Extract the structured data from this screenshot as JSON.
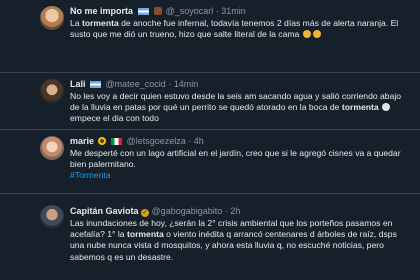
{
  "tweets": [
    {
      "name": "No me importa",
      "handle": "@_soyocarl",
      "time": "31min",
      "icons": [
        "argentina-flag-icon",
        "coffee-icon"
      ],
      "t1": "La ",
      "hl": "tormenta",
      "t2": " de anoche fue infernal, todavía tenemos 2 días más de alerta naranja. El susto que me dió un trueno, hizo que salte literal de la cama ",
      "emoji": [
        "grimacing-face-icon",
        "sweat-face-icon"
      ]
    },
    {
      "name": "Lali",
      "handle": "@matee_cocid",
      "time": "14min",
      "icons": [
        "argentina-flag-icon"
      ],
      "t1": "No les voy a decir quien estuvo desde la seis am sacando agua y salió corriendo abajo de la lluvia en patas por qué un perrito se quedó atorado en la boca de ",
      "hl": "tormenta",
      "t2": " empece el dia con todo",
      "emoji": [
        "skull-crossbones-icon"
      ]
    },
    {
      "name": "marie",
      "handle": "@letsgoezelza",
      "time": "4h",
      "icons": [
        "sunflower-icon",
        "italy-flag-icon"
      ],
      "t1": "Me desperté con un lago artificial en el jardín, creo que si le agregó cisnes va a quedar bien palermitano. ",
      "hashtag": "#Tormenta"
    },
    {
      "name": "Capitán Gaviota",
      "handle": "@gabogabigabito",
      "time": "2h",
      "icons": [
        "verified-badge-icon"
      ],
      "t1": "Las inundaciones de hoy, ¿serán la 2° crisis ambiental que los porteños pasamos en acefalía? 1° la ",
      "hl": "tormenta",
      "t2": " o viento inédita q arrancó centenares d árboles de raíz, dsps una nube nunca vista d mosquitos, y ahora esta lluvia q, no escuché noticias, pero sabemos q es un desastre."
    }
  ]
}
